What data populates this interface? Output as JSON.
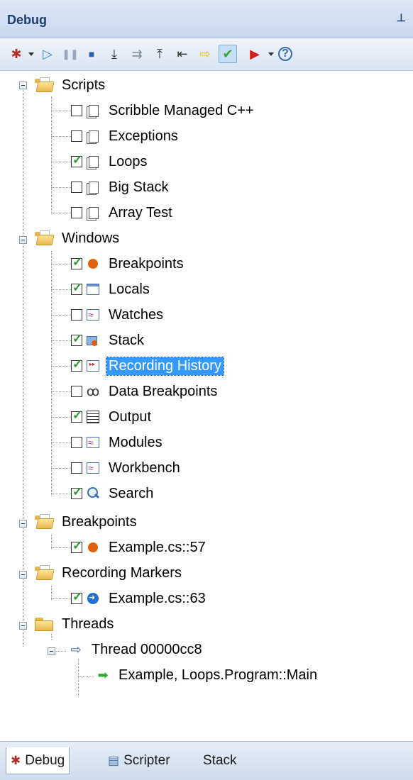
{
  "panel": {
    "title": "Debug",
    "pin_icon": "pin-icon"
  },
  "toolbar": {
    "buttons": [
      {
        "name": "debug-bug-icon",
        "glyph": "🐞"
      },
      {
        "name": "run-icon",
        "glyph": "▷"
      },
      {
        "name": "pause-icon",
        "glyph": "⏸"
      },
      {
        "name": "stop-icon",
        "glyph": "■"
      },
      {
        "name": "step-into-icon",
        "glyph": "⇲"
      },
      {
        "name": "step-over-icon",
        "glyph": "⇉"
      },
      {
        "name": "step-out-icon",
        "glyph": "⇱"
      },
      {
        "name": "step-back-icon",
        "glyph": "⇦"
      },
      {
        "name": "run-to-cursor-icon",
        "glyph": "⇨"
      },
      {
        "name": "check-icon",
        "glyph": "✔"
      },
      {
        "name": "record-run-icon",
        "glyph": "▶"
      },
      {
        "name": "help-icon",
        "glyph": "?"
      }
    ]
  },
  "tree": {
    "scripts": {
      "label": "Scripts",
      "items": [
        {
          "label": "Scribble Managed C++",
          "checked": false
        },
        {
          "label": "Exceptions",
          "checked": false
        },
        {
          "label": "Loops",
          "checked": true
        },
        {
          "label": "Big Stack",
          "checked": false
        },
        {
          "label": "Array Test",
          "checked": false
        }
      ]
    },
    "windows": {
      "label": "Windows",
      "items": [
        {
          "label": "Breakpoints",
          "checked": true,
          "icon": "breakpoint-icon"
        },
        {
          "label": "Locals",
          "checked": true,
          "icon": "locals-icon"
        },
        {
          "label": "Watches",
          "checked": false,
          "icon": "watches-icon"
        },
        {
          "label": "Stack",
          "checked": true,
          "icon": "stack-icon"
        },
        {
          "label": "Recording History",
          "checked": true,
          "icon": "recording-history-icon",
          "selected": true
        },
        {
          "label": "Data Breakpoints",
          "checked": false,
          "icon": "glasses-icon"
        },
        {
          "label": "Output",
          "checked": true,
          "icon": "output-icon"
        },
        {
          "label": "Modules",
          "checked": false,
          "icon": "modules-icon"
        },
        {
          "label": "Workbench",
          "checked": false,
          "icon": "workbench-icon"
        },
        {
          "label": "Search",
          "checked": true,
          "icon": "search-icon"
        }
      ]
    },
    "breakpoints": {
      "label": "Breakpoints",
      "items": [
        {
          "label": "Example.cs::57",
          "checked": true
        }
      ]
    },
    "recording_markers": {
      "label": "Recording Markers",
      "items": [
        {
          "label": "Example.cs::63",
          "checked": true
        }
      ]
    },
    "threads": {
      "label": "Threads",
      "thread": "Thread 00000cc8",
      "frame": "Example, Loops.Program::Main"
    }
  },
  "tabs": [
    {
      "label": "Debug",
      "active": true
    },
    {
      "label": "Scripter",
      "active": false
    },
    {
      "label": "Stack",
      "active": false
    }
  ]
}
